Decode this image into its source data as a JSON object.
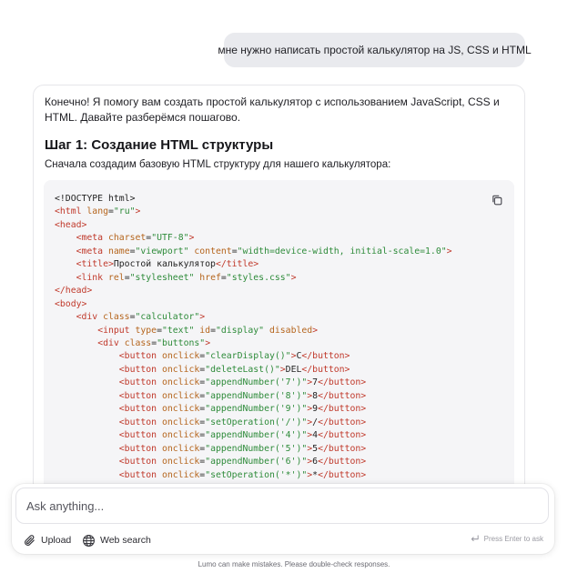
{
  "user_message": "мне нужно написать простой калькулятор на JS, CSS и HTML",
  "answer": {
    "intro": "Конечно! Я помогу вам создать простой калькулятор с использованием JavaScript, CSS и HTML. Давайте разберёмся пошагово.",
    "step_title": "Шаг 1: Создание HTML структуры",
    "step_desc": "Сначала создадим базовую HTML структуру для нашего калькулятора:",
    "code_language": "html"
  },
  "code_lines": [
    [
      [
        "t",
        "<!DOCTYPE html>"
      ]
    ],
    [
      [
        "g",
        "<html"
      ],
      [
        "t",
        " "
      ],
      [
        "a",
        "lang"
      ],
      [
        "t",
        "="
      ],
      [
        "s",
        "\"ru\""
      ],
      [
        "g",
        ">"
      ]
    ],
    [
      [
        "g",
        "<head>"
      ]
    ],
    [
      [
        "t",
        "    "
      ],
      [
        "g",
        "<meta"
      ],
      [
        "t",
        " "
      ],
      [
        "a",
        "charset"
      ],
      [
        "t",
        "="
      ],
      [
        "s",
        "\"UTF-8\""
      ],
      [
        "g",
        ">"
      ]
    ],
    [
      [
        "t",
        "    "
      ],
      [
        "g",
        "<meta"
      ],
      [
        "t",
        " "
      ],
      [
        "a",
        "name"
      ],
      [
        "t",
        "="
      ],
      [
        "s",
        "\"viewport\""
      ],
      [
        "t",
        " "
      ],
      [
        "a",
        "content"
      ],
      [
        "t",
        "="
      ],
      [
        "s",
        "\"width=device-width, initial-scale=1.0\""
      ],
      [
        "g",
        ">"
      ]
    ],
    [
      [
        "t",
        "    "
      ],
      [
        "g",
        "<title>"
      ],
      [
        "t",
        "Простой калькулятор"
      ],
      [
        "g",
        "</title>"
      ]
    ],
    [
      [
        "t",
        "    "
      ],
      [
        "g",
        "<link"
      ],
      [
        "t",
        " "
      ],
      [
        "a",
        "rel"
      ],
      [
        "t",
        "="
      ],
      [
        "s",
        "\"stylesheet\""
      ],
      [
        "t",
        " "
      ],
      [
        "a",
        "href"
      ],
      [
        "t",
        "="
      ],
      [
        "s",
        "\"styles.css\""
      ],
      [
        "g",
        ">"
      ]
    ],
    [
      [
        "g",
        "</head>"
      ]
    ],
    [
      [
        "g",
        "<body>"
      ]
    ],
    [
      [
        "t",
        "    "
      ],
      [
        "g",
        "<div"
      ],
      [
        "t",
        " "
      ],
      [
        "a",
        "class"
      ],
      [
        "t",
        "="
      ],
      [
        "s",
        "\"calculator\""
      ],
      [
        "g",
        ">"
      ]
    ],
    [
      [
        "t",
        "        "
      ],
      [
        "g",
        "<input"
      ],
      [
        "t",
        " "
      ],
      [
        "a",
        "type"
      ],
      [
        "t",
        "="
      ],
      [
        "s",
        "\"text\""
      ],
      [
        "t",
        " "
      ],
      [
        "a",
        "id"
      ],
      [
        "t",
        "="
      ],
      [
        "s",
        "\"display\""
      ],
      [
        "t",
        " "
      ],
      [
        "a",
        "disabled"
      ],
      [
        "g",
        ">"
      ]
    ],
    [
      [
        "t",
        "        "
      ],
      [
        "g",
        "<div"
      ],
      [
        "t",
        " "
      ],
      [
        "a",
        "class"
      ],
      [
        "t",
        "="
      ],
      [
        "s",
        "\"buttons\""
      ],
      [
        "g",
        ">"
      ]
    ],
    [
      [
        "t",
        "            "
      ],
      [
        "g",
        "<button"
      ],
      [
        "t",
        " "
      ],
      [
        "a",
        "onclick"
      ],
      [
        "t",
        "="
      ],
      [
        "s",
        "\"clearDisplay()\""
      ],
      [
        "g",
        ">"
      ],
      [
        "t",
        "C"
      ],
      [
        "g",
        "</button>"
      ]
    ],
    [
      [
        "t",
        "            "
      ],
      [
        "g",
        "<button"
      ],
      [
        "t",
        " "
      ],
      [
        "a",
        "onclick"
      ],
      [
        "t",
        "="
      ],
      [
        "s",
        "\"deleteLast()\""
      ],
      [
        "g",
        ">"
      ],
      [
        "t",
        "DEL"
      ],
      [
        "g",
        "</button>"
      ]
    ],
    [
      [
        "t",
        "            "
      ],
      [
        "g",
        "<button"
      ],
      [
        "t",
        " "
      ],
      [
        "a",
        "onclick"
      ],
      [
        "t",
        "="
      ],
      [
        "s",
        "\"appendNumber('7')\""
      ],
      [
        "g",
        ">"
      ],
      [
        "t",
        "7"
      ],
      [
        "g",
        "</button>"
      ]
    ],
    [
      [
        "t",
        "            "
      ],
      [
        "g",
        "<button"
      ],
      [
        "t",
        " "
      ],
      [
        "a",
        "onclick"
      ],
      [
        "t",
        "="
      ],
      [
        "s",
        "\"appendNumber('8')\""
      ],
      [
        "g",
        ">"
      ],
      [
        "t",
        "8"
      ],
      [
        "g",
        "</button>"
      ]
    ],
    [
      [
        "t",
        "            "
      ],
      [
        "g",
        "<button"
      ],
      [
        "t",
        " "
      ],
      [
        "a",
        "onclick"
      ],
      [
        "t",
        "="
      ],
      [
        "s",
        "\"appendNumber('9')\""
      ],
      [
        "g",
        ">"
      ],
      [
        "t",
        "9"
      ],
      [
        "g",
        "</button>"
      ]
    ],
    [
      [
        "t",
        "            "
      ],
      [
        "g",
        "<button"
      ],
      [
        "t",
        " "
      ],
      [
        "a",
        "onclick"
      ],
      [
        "t",
        "="
      ],
      [
        "s",
        "\"setOperation('/')\""
      ],
      [
        "g",
        ">"
      ],
      [
        "t",
        "/"
      ],
      [
        "g",
        "</button>"
      ]
    ],
    [
      [
        "t",
        "            "
      ],
      [
        "g",
        "<button"
      ],
      [
        "t",
        " "
      ],
      [
        "a",
        "onclick"
      ],
      [
        "t",
        "="
      ],
      [
        "s",
        "\"appendNumber('4')\""
      ],
      [
        "g",
        ">"
      ],
      [
        "t",
        "4"
      ],
      [
        "g",
        "</button>"
      ]
    ],
    [
      [
        "t",
        "            "
      ],
      [
        "g",
        "<button"
      ],
      [
        "t",
        " "
      ],
      [
        "a",
        "onclick"
      ],
      [
        "t",
        "="
      ],
      [
        "s",
        "\"appendNumber('5')\""
      ],
      [
        "g",
        ">"
      ],
      [
        "t",
        "5"
      ],
      [
        "g",
        "</button>"
      ]
    ],
    [
      [
        "t",
        "            "
      ],
      [
        "g",
        "<button"
      ],
      [
        "t",
        " "
      ],
      [
        "a",
        "onclick"
      ],
      [
        "t",
        "="
      ],
      [
        "s",
        "\"appendNumber('6')\""
      ],
      [
        "g",
        ">"
      ],
      [
        "t",
        "6"
      ],
      [
        "g",
        "</button>"
      ]
    ],
    [
      [
        "t",
        "            "
      ],
      [
        "g",
        "<button"
      ],
      [
        "t",
        " "
      ],
      [
        "a",
        "onclick"
      ],
      [
        "t",
        "="
      ],
      [
        "s",
        "\"setOperation('*')\""
      ],
      [
        "g",
        ">"
      ],
      [
        "t",
        "*"
      ],
      [
        "g",
        "</button>"
      ]
    ]
  ],
  "code_colors": {
    "tag": "#c0392b",
    "attr": "#b5651d",
    "string": "#2e8b3a",
    "text": "#222222"
  },
  "composer": {
    "placeholder": "Ask anything...",
    "upload_label": "Upload",
    "upload_icon": "paperclip-icon",
    "web_search_label": "Web search",
    "web_search_icon": "globe-icon",
    "enter_hint": "Press Enter to ask"
  },
  "disclaimer": "Lumo can make mistakes. Please double-check responses."
}
